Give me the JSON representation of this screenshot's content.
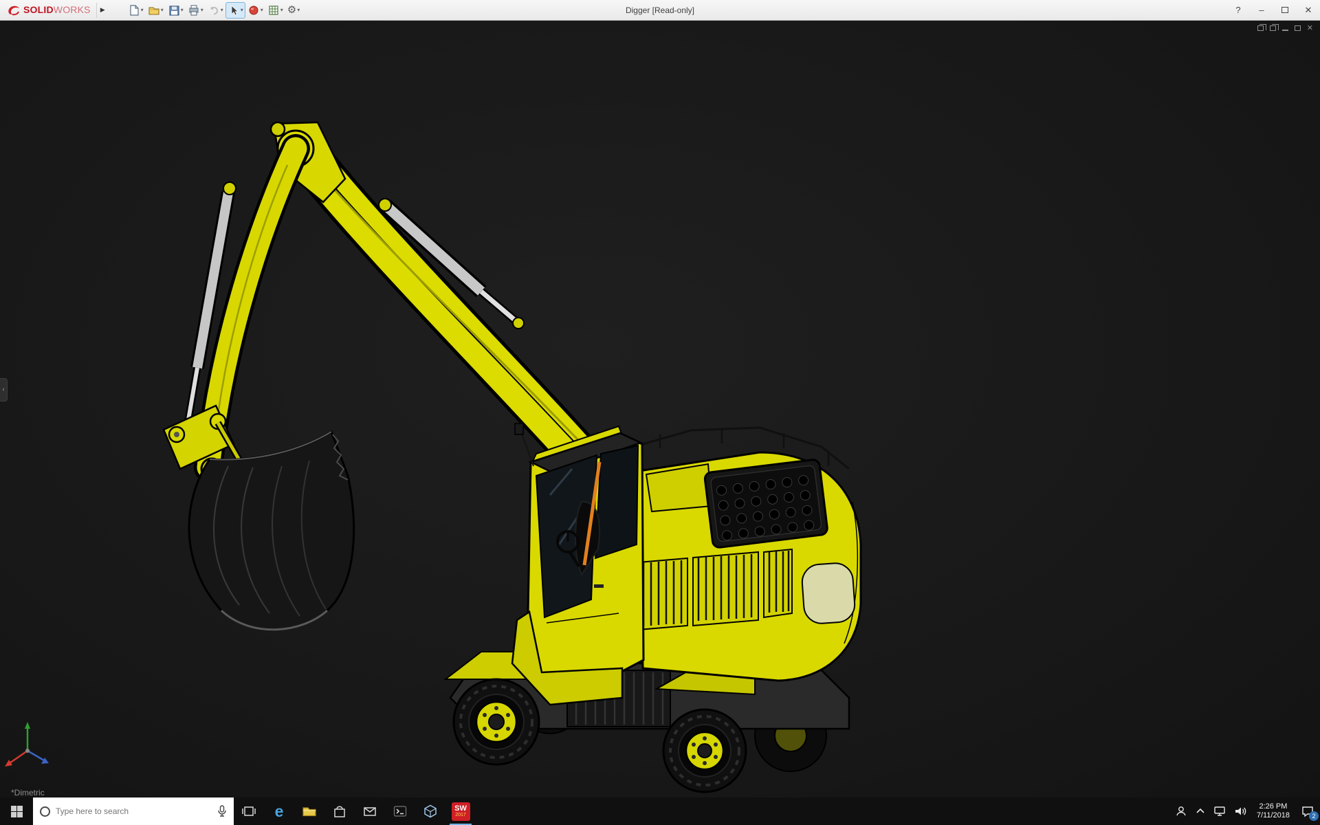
{
  "titlebar": {
    "brand_solid": "SOLID",
    "brand_works": "WORKS",
    "title": "Digger [Read-only]",
    "help_glyph": "?",
    "minimize_glyph": "–",
    "close_glyph": "✕"
  },
  "glyphs": {
    "dropdown": "▾",
    "flyout": "▶",
    "left_tab": "‹",
    "gear": "⚙",
    "viewport_close": "✕"
  },
  "toolbar": {
    "icons": [
      "new-document",
      "open",
      "save",
      "print",
      "undo",
      "select-cursor",
      "appearances",
      "design-table",
      "options-gear"
    ]
  },
  "viewport": {
    "view_orientation_label": "*Dimetric",
    "background_color": "#181818",
    "model_primary_color": "#dcdc00",
    "triad_axis_colors": {
      "x": "#d23b2f",
      "y": "#2f9e2f",
      "z": "#3b63c4"
    }
  },
  "taskbar": {
    "search": {
      "placeholder": "Type here to search"
    },
    "edge_glyph": "e",
    "pinned": [
      "task-view",
      "edge",
      "file-explorer",
      "store",
      "mail",
      "command-prompt",
      "3d-builder",
      "solidworks-2017"
    ],
    "solidworks_tile": {
      "top": "SW",
      "year": "2017"
    },
    "tray": {
      "time": "2:26 PM",
      "date": "7/11/2018",
      "notification_count": "2"
    }
  }
}
